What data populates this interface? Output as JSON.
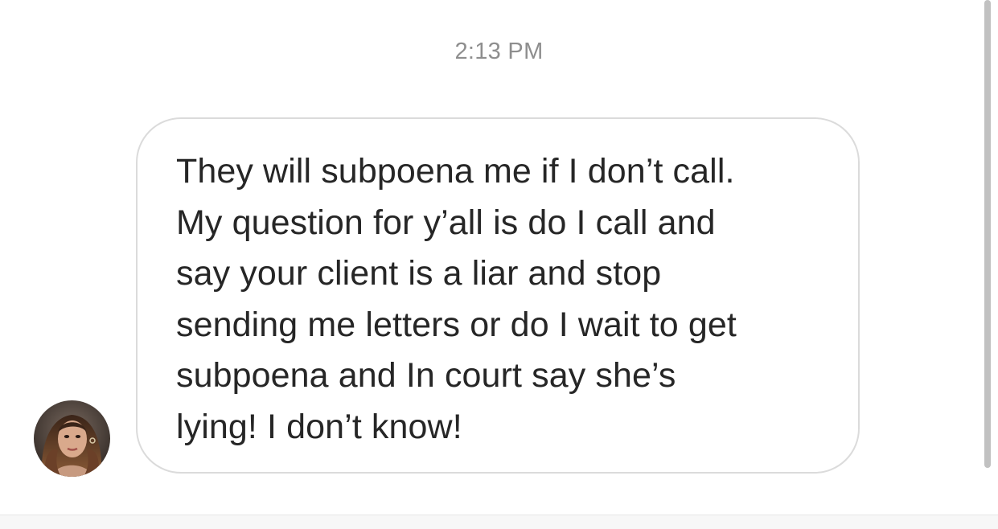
{
  "thread": {
    "timestamp": "2:13 PM",
    "messages": [
      {
        "sender": "incoming",
        "text": "They will subpoena me if I don’t call.\nMy question for y’all is do I call and\nsay your client is a liar and stop\nsending me letters or do I wait to get\nsubpoena and In court say she’s\nlying! I don’t know!"
      }
    ]
  },
  "colors": {
    "bubble_border": "#dbdbdb",
    "message_text": "#262626",
    "timestamp_text": "#8e8e8e",
    "scrollbar": "#c1c1c1"
  }
}
